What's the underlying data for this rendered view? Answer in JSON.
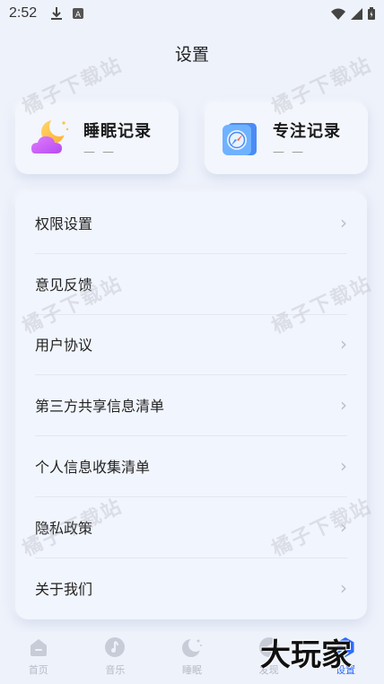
{
  "status_bar": {
    "time": "2:52"
  },
  "header": {
    "title": "设置"
  },
  "records": [
    {
      "label": "睡眠记录",
      "sub": "— —",
      "icon": "moon-cloud-icon"
    },
    {
      "label": "专注记录",
      "sub": "— —",
      "icon": "compass-icon"
    }
  ],
  "menu": {
    "items": [
      {
        "label": "权限设置",
        "chevron": true
      },
      {
        "label": "意见反馈",
        "chevron": false
      },
      {
        "label": "用户协议",
        "chevron": true
      },
      {
        "label": "第三方共享信息清单",
        "chevron": true
      },
      {
        "label": "个人信息收集清单",
        "chevron": true
      },
      {
        "label": "隐私政策",
        "chevron": true
      },
      {
        "label": "关于我们",
        "chevron": true
      }
    ]
  },
  "tabs": [
    {
      "label": "首页",
      "icon": "home-icon",
      "active": false
    },
    {
      "label": "音乐",
      "icon": "music-icon",
      "active": false
    },
    {
      "label": "睡眠",
      "icon": "moon-icon",
      "active": false
    },
    {
      "label": "发现",
      "icon": "discover-icon",
      "active": false
    },
    {
      "label": "设置",
      "icon": "settings-icon",
      "active": true
    }
  ],
  "watermarks": {
    "text": "橘子下载站",
    "brand": "大玩家"
  },
  "colors": {
    "background": "#eef2fb",
    "accent": "#2f6bff",
    "inactive": "#b5bac6"
  }
}
